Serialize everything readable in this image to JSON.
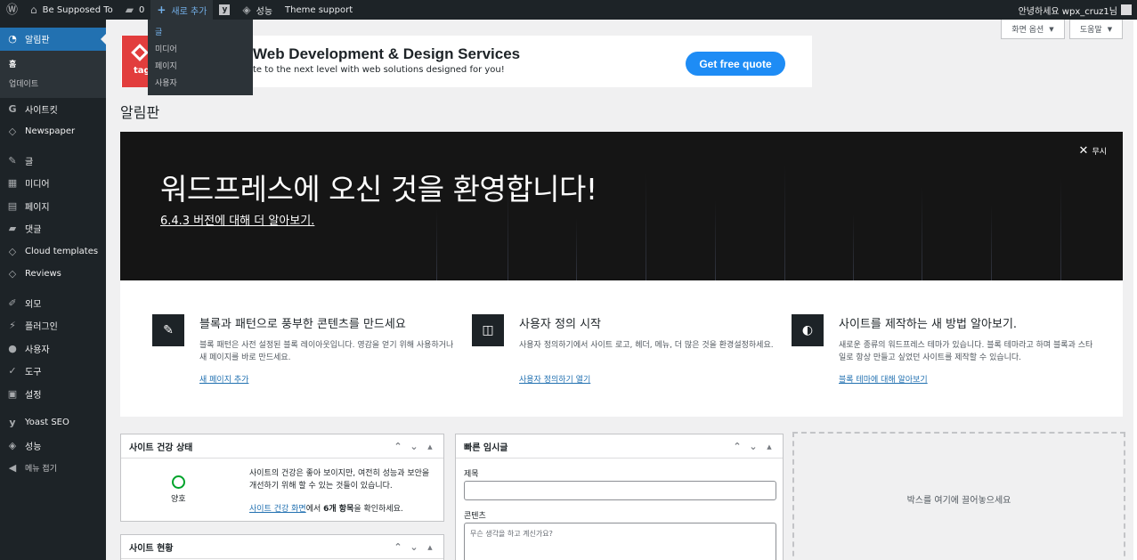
{
  "admin_bar": {
    "site_name": "Be Supposed To",
    "comments_count": "0",
    "new_label": "새로 추가",
    "performance_label": "성능",
    "theme_support_label": "Theme support",
    "greeting": "안녕하세요 wpx_cruz1님"
  },
  "new_dropdown": {
    "items": [
      "글",
      "미디어",
      "페이지",
      "사용자"
    ]
  },
  "sidebar": {
    "dashboard": "알림판",
    "home": "홈",
    "updates": "업데이트",
    "sitekit": "사이트킷",
    "newspaper": "Newspaper",
    "posts": "글",
    "media": "미디어",
    "pages": "페이지",
    "comments": "댓글",
    "cloud_templates": "Cloud templates",
    "reviews": "Reviews",
    "appearance": "외모",
    "plugins": "플러그인",
    "users": "사용자",
    "tools": "도구",
    "settings": "설정",
    "yoast": "Yoast SEO",
    "performance": "성능",
    "collapse": "메뉴 접기"
  },
  "screen_options": {
    "screen_options_label": "화면 옵션",
    "help_label": "도움말"
  },
  "ad_banner": {
    "logo_text": "tag",
    "title": "Web Development & Design Services",
    "subtitle": "te to the next level with web solutions designed for you!",
    "button": "Get free quote"
  },
  "page_title": "알림판",
  "welcome": {
    "heading": "워드프레스에 오신 것을 환영합니다!",
    "version_link": "6.4.3 버전에 대해 더 알아보기.",
    "dismiss": "무시",
    "columns": [
      {
        "title": "블록과 패턴으로 풍부한 콘텐츠를 만드세요",
        "text": "블록 패턴은 사전 설정된 블록 레이아웃입니다. 영감을 얻기 위해 사용하거나 새 페이지를 바로 만드세요.",
        "link": "새 페이지 추가"
      },
      {
        "title": "사용자 정의 시작",
        "text": "사용자 정의하기에서 사이트 로고, 헤더, 메뉴, 더 많은 것을 환경설정하세요.",
        "link": "사용자 정의하기 열기"
      },
      {
        "title": "사이트를 제작하는 새 방법 알아보기.",
        "text": "새로운 종류의 워드프레스 테마가 있습니다. 블록 테마라고 하며 블록과 스타일로 항상 만들고 싶었던 사이트를 제작할 수 있습니다.",
        "link": "블록 테마에 대해 알아보기"
      }
    ]
  },
  "site_health": {
    "title": "사이트 건강 상태",
    "status": "양호",
    "text": "사이트의 건강은 좋아 보이지만, 여전히 성능과 보안을 개선하기 위해 할 수 있는 것들이 있습니다.",
    "link": "사이트 건강 화면",
    "suffix_pre": "에서 ",
    "count": "6개 항목",
    "suffix_post": "을 확인하세요."
  },
  "site_status": {
    "title": "사이트 현황"
  },
  "quick_draft": {
    "title": "빠른 임시글",
    "title_label": "제목",
    "content_label": "콘텐츠",
    "content_placeholder": "무슨 생각을 하고 계신가요?"
  },
  "dropzone": {
    "text": "박스를 여기에 끌어놓으세요"
  }
}
